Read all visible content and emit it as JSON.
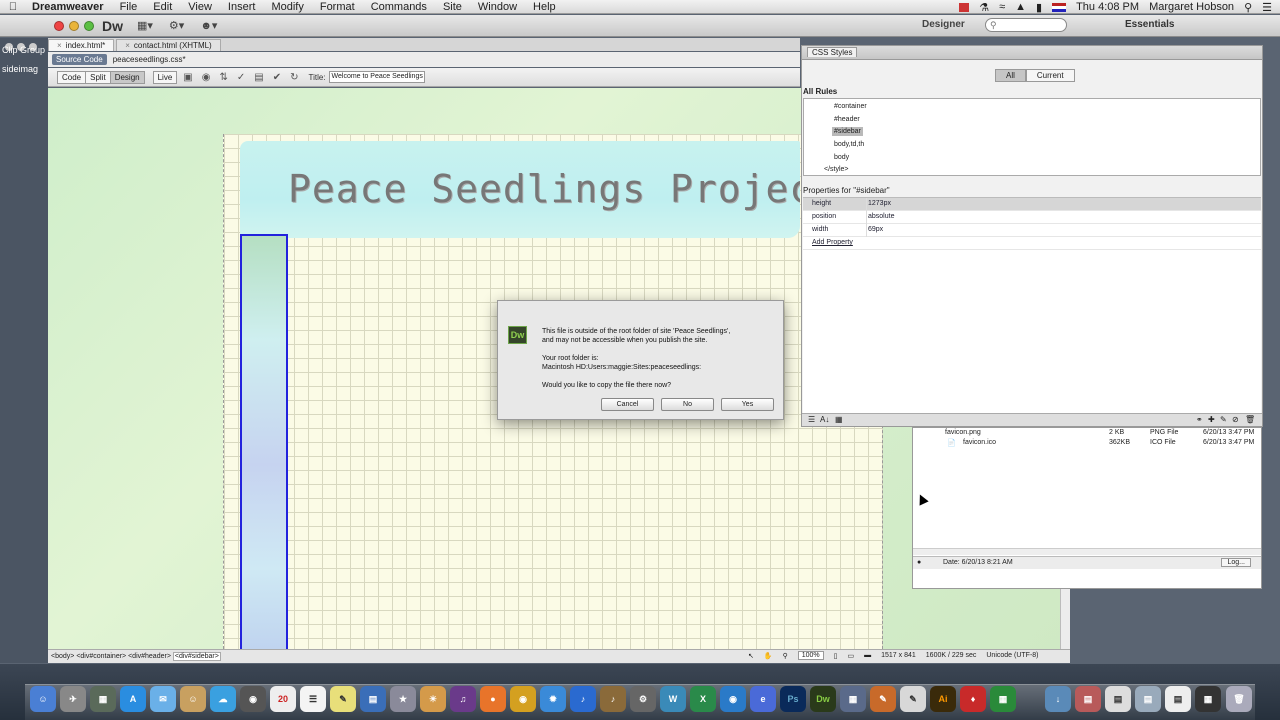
{
  "menubar": {
    "app_name": "Dreamweaver",
    "items": [
      "File",
      "Edit",
      "View",
      "Insert",
      "Modify",
      "Format",
      "Commands",
      "Site",
      "Window",
      "Help"
    ],
    "clock": "Thu 4:08 PM",
    "user": "Margaret Hobson"
  },
  "appbar": {
    "logo": "Dw",
    "workspace": "Designer",
    "essentials": "Essentials"
  },
  "leftstrip": {
    "clip_group": "Clip Group",
    "sidebar_label": "sideimag"
  },
  "doctabs": [
    {
      "label": "index.html*",
      "active": true
    },
    {
      "label": "contact.html (XHTML)",
      "active": false
    }
  ],
  "related": {
    "source_code": "Source Code",
    "css_file": "peaceseedlings.css*"
  },
  "doctoolbar": {
    "views": [
      "Code",
      "Split",
      "Design",
      "Live"
    ],
    "selected_view": "Design",
    "title_label": "Title:",
    "title_value": "Welcome to Peace Seedlings"
  },
  "design": {
    "header_text": "Peace  Seedlings  Project"
  },
  "statusbar": {
    "tags": [
      "<body>",
      "<div#container>",
      "<div#header>",
      "<div#sidebar>"
    ],
    "zoom": "100%",
    "dimensions": "1517 x 841",
    "size_time": "1600K / 229 sec",
    "encoding": "Unicode (UTF-8)"
  },
  "css_panel": {
    "tab_label": "CSS Styles",
    "mode_buttons": [
      "All",
      "Current"
    ],
    "selected_mode": "All",
    "all_rules_label": "All Rules",
    "rules": [
      "#container",
      "#header",
      "#sidebar",
      "body,td,th",
      "body",
      "</style>"
    ],
    "selected_rule": "#sidebar",
    "properties_label": "Properties for \"#sidebar\"",
    "properties": [
      {
        "name": "height",
        "value": "1273px"
      },
      {
        "name": "position",
        "value": "absolute"
      },
      {
        "name": "width",
        "value": "69px"
      }
    ],
    "add_property": "Add Property"
  },
  "files_panel": {
    "rows": [
      {
        "name": "favicon.png",
        "size": "2 KB",
        "type": "PNG File",
        "date": "6/20/13 3:47 PM"
      },
      {
        "name": "favicon.ico",
        "size": "362KB",
        "type": "ICO File",
        "date": "6/20/13 3:47 PM"
      }
    ],
    "date_status": "Date: 6/20/13 8:21 AM",
    "log_button": "Log..."
  },
  "dialog": {
    "icon": "Dw",
    "line1": "This file is outside of the root folder of site 'Peace Seedlings',",
    "line2": "and may not be accessible when you publish the site.",
    "root_label": "Your root folder is:",
    "root_path": "Macintosh HD:Users:maggie:Sites:peaceseedlings:",
    "question": "Would you like to copy the file there now?",
    "buttons": {
      "cancel": "Cancel",
      "no": "No",
      "yes": "Yes"
    }
  },
  "dock": {
    "calendar_day": "20",
    "icons": [
      "Ps",
      "Dw",
      "Ai"
    ]
  },
  "colors": {
    "selection_blue": "#2222dd",
    "header_cyan": "#c8f2ef",
    "grid_bg": "#fbfbe6"
  }
}
